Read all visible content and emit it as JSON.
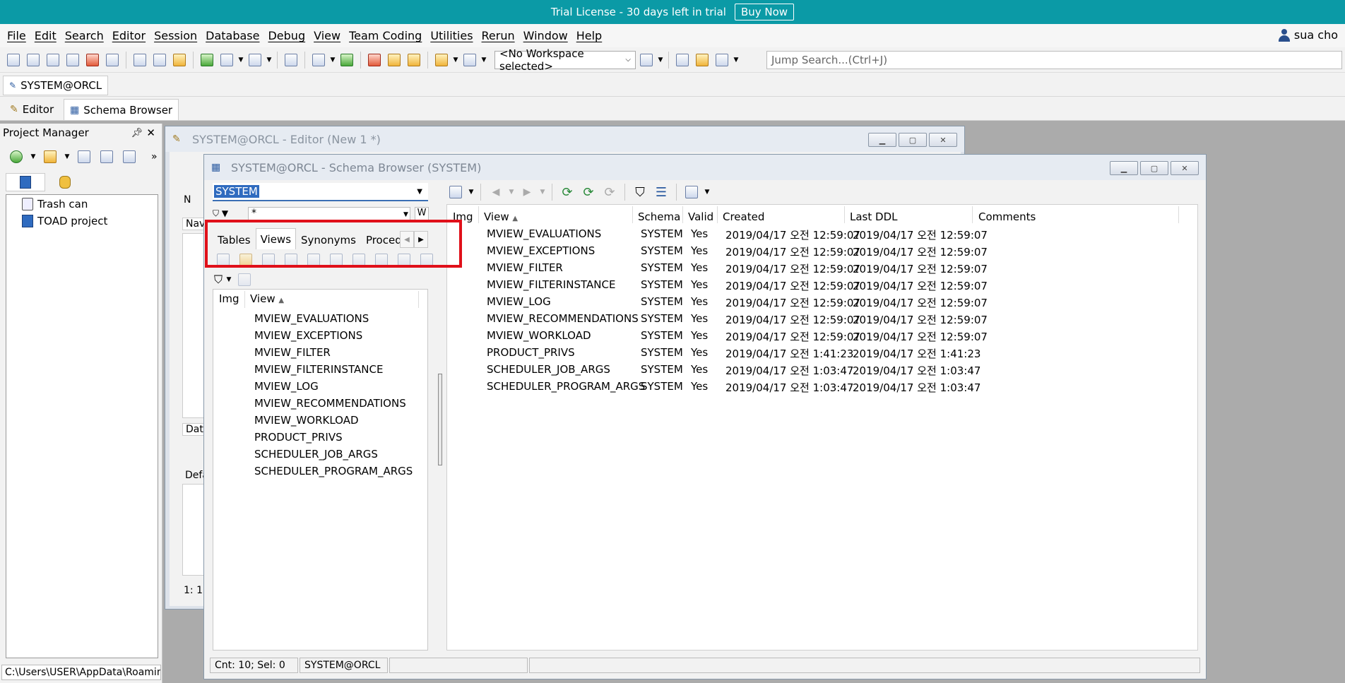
{
  "banner": {
    "text": "Trial License - 30 days left in trial",
    "buy_label": "Buy Now"
  },
  "menu": {
    "items": [
      "File",
      "Edit",
      "Search",
      "Editor",
      "Session",
      "Database",
      "Debug",
      "View",
      "Team Coding",
      "Utilities",
      "Rerun",
      "Window",
      "Help"
    ],
    "user": "sua cho"
  },
  "toolbar": {
    "workspace": "<No Workspace selected>",
    "jump_placeholder": "Jump Search...(Ctrl+J)"
  },
  "connection_tab": "SYSTEM@ORCL",
  "view_tabs": [
    "Editor",
    "Schema Browser"
  ],
  "project_manager": {
    "title": "Project Manager",
    "tree": [
      "Trash can",
      "TOAD project"
    ],
    "path": "C:\\Users\\USER\\AppData\\Roamin"
  },
  "editor_window": {
    "title": "SYSTEM@ORCL - Editor (New 1 *)",
    "fragments": [
      "N",
      "Navi",
      "Data",
      "Defa",
      "1:  1"
    ]
  },
  "schema_browser": {
    "title": "SYSTEM@ORCL - Schema Browser (SYSTEM)",
    "schema": "SYSTEM",
    "filter_value": "*",
    "filter_w": "W",
    "object_tabs": [
      "Tables",
      "Views",
      "Synonyms",
      "Procedures"
    ],
    "active_tab": "Views",
    "left_headers": [
      "Img",
      "View"
    ],
    "views": [
      "MVIEW_EVALUATIONS",
      "MVIEW_EXCEPTIONS",
      "MVIEW_FILTER",
      "MVIEW_FILTERINSTANCE",
      "MVIEW_LOG",
      "MVIEW_RECOMMENDATIONS",
      "MVIEW_WORKLOAD",
      "PRODUCT_PRIVS",
      "SCHEDULER_JOB_ARGS",
      "SCHEDULER_PROGRAM_ARGS"
    ],
    "right_headers": [
      "Img",
      "View",
      "Schema",
      "Valid",
      "Created",
      "Last DDL",
      "Comments"
    ],
    "rows": [
      {
        "view": "MVIEW_EVALUATIONS",
        "schema": "SYSTEM",
        "valid": "Yes",
        "created": "2019/04/17 오전 12:59:07",
        "last_ddl": "2019/04/17 오전 12:59:07"
      },
      {
        "view": "MVIEW_EXCEPTIONS",
        "schema": "SYSTEM",
        "valid": "Yes",
        "created": "2019/04/17 오전 12:59:07",
        "last_ddl": "2019/04/17 오전 12:59:07"
      },
      {
        "view": "MVIEW_FILTER",
        "schema": "SYSTEM",
        "valid": "Yes",
        "created": "2019/04/17 오전 12:59:07",
        "last_ddl": "2019/04/17 오전 12:59:07"
      },
      {
        "view": "MVIEW_FILTERINSTANCE",
        "schema": "SYSTEM",
        "valid": "Yes",
        "created": "2019/04/17 오전 12:59:07",
        "last_ddl": "2019/04/17 오전 12:59:07"
      },
      {
        "view": "MVIEW_LOG",
        "schema": "SYSTEM",
        "valid": "Yes",
        "created": "2019/04/17 오전 12:59:07",
        "last_ddl": "2019/04/17 오전 12:59:07"
      },
      {
        "view": "MVIEW_RECOMMENDATIONS",
        "schema": "SYSTEM",
        "valid": "Yes",
        "created": "2019/04/17 오전 12:59:07",
        "last_ddl": "2019/04/17 오전 12:59:07"
      },
      {
        "view": "MVIEW_WORKLOAD",
        "schema": "SYSTEM",
        "valid": "Yes",
        "created": "2019/04/17 오전 12:59:07",
        "last_ddl": "2019/04/17 오전 12:59:07"
      },
      {
        "view": "PRODUCT_PRIVS",
        "schema": "SYSTEM",
        "valid": "Yes",
        "created": "2019/04/17 오전 1:41:23",
        "last_ddl": "2019/04/17 오전 1:41:23"
      },
      {
        "view": "SCHEDULER_JOB_ARGS",
        "schema": "SYSTEM",
        "valid": "Yes",
        "created": "2019/04/17 오전 1:03:47",
        "last_ddl": "2019/04/17 오전 1:03:47"
      },
      {
        "view": "SCHEDULER_PROGRAM_ARGS",
        "schema": "SYSTEM",
        "valid": "Yes",
        "created": "2019/04/17 오전 1:03:47",
        "last_ddl": "2019/04/17 오전 1:03:47"
      }
    ],
    "status_count": "Cnt: 10; Sel: 0",
    "status_conn": "SYSTEM@ORCL"
  },
  "colors": {
    "banner": "#0b9aa6",
    "highlight": "#e0101a",
    "selection": "#2f6bbf"
  }
}
